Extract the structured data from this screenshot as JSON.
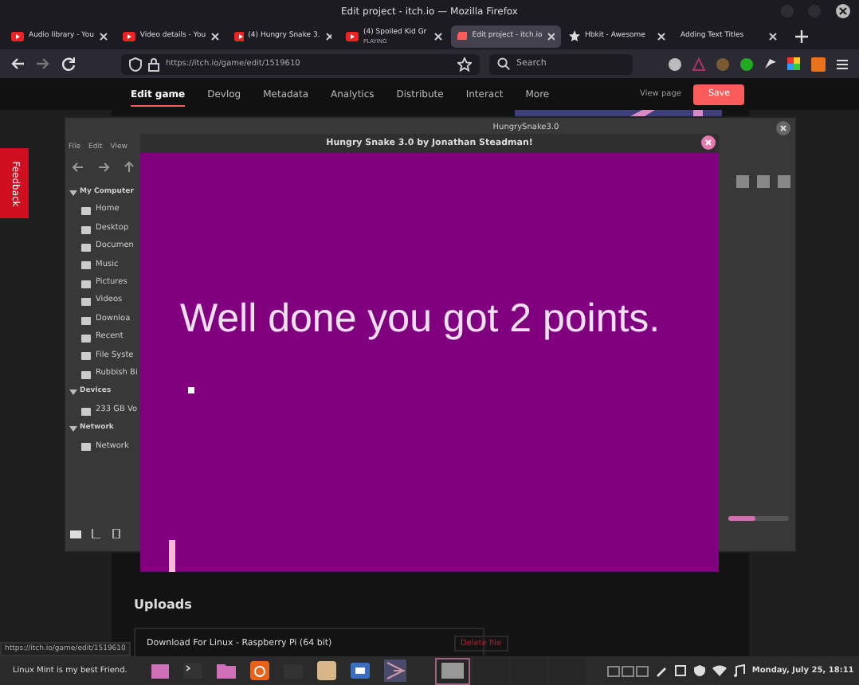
{
  "window": {
    "title": "Edit project - itch.io — Mozilla Firefox"
  },
  "tabs": [
    {
      "label": "Audio library - You",
      "selected": false,
      "kind": "video"
    },
    {
      "label": "Video details - You",
      "selected": false,
      "kind": "video"
    },
    {
      "label": "(4) Hungry Snake 3.",
      "selected": false,
      "kind": "video"
    },
    {
      "label": "(4) Spoiled Kid Gr",
      "status": "PLAYING",
      "selected": false,
      "kind": "video"
    },
    {
      "label": "Edit project - itch.io",
      "selected": true,
      "kind": "itch"
    },
    {
      "label": "Hbkit - Awesome",
      "selected": false,
      "kind": "plain"
    },
    {
      "label": "Adding Text Titles",
      "selected": false,
      "kind": "none"
    }
  ],
  "address_bar": {
    "url": "https://itch.io/game/edit/1519610"
  },
  "search": {
    "placeholder": "Search"
  },
  "itch_nav": {
    "items": [
      {
        "label": "Edit game",
        "selected": true
      },
      {
        "label": "Devlog",
        "selected": false
      },
      {
        "label": "Metadata",
        "selected": false
      },
      {
        "label": "Analytics",
        "selected": false
      },
      {
        "label": "Distribute",
        "selected": false
      },
      {
        "label": "Interact",
        "selected": false
      },
      {
        "label": "More",
        "selected": false
      }
    ],
    "view_page": "View page",
    "save": "Save"
  },
  "feedback": "Feedback",
  "file_manager": {
    "title": "HungrySnake3.0",
    "menu": [
      "File",
      "Edit",
      "View"
    ],
    "sections": [
      {
        "label": "My Computer",
        "expanded": true,
        "children": [
          "Home",
          "Desktop",
          "Documen",
          "Music",
          "Pictures",
          "Videos",
          "Downloa",
          "Recent",
          "File Syste",
          "Rubbish Bi"
        ]
      },
      {
        "label": "Devices",
        "expanded": true,
        "children": [
          "233 GB Vo"
        ]
      },
      {
        "label": "Network",
        "expanded": true,
        "children": [
          "Network"
        ]
      }
    ],
    "zoom_slider": {
      "level": 0.45
    }
  },
  "game_window": {
    "title": "Hungry Snake 3.0 by Jonathan Steadman!",
    "message": "Well done you got 2 points."
  },
  "uploads": {
    "heading": "Uploads",
    "file": "Download For Linux - Raspberry Pi (64 bit)",
    "delete": "Delete file"
  },
  "status_url": "https://itch.io/game/edit/1519610",
  "taskbar": {
    "menu_label": "Linux Mint is my best Friend.",
    "clock": "Monday, July 25, 18:11"
  }
}
